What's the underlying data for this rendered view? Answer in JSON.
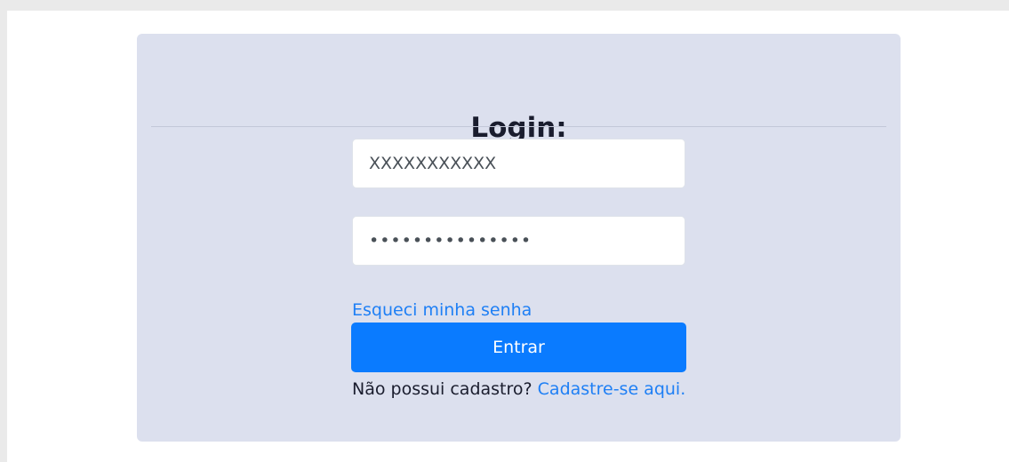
{
  "login": {
    "title": "Login:",
    "username_value": "XXXXXXXXXXX",
    "password_value": "PasswordExample",
    "forgot_label": "Esqueci minha senha",
    "submit_label": "Entrar",
    "signup_prompt": "Não possui cadastro?",
    "signup_link": "Cadastre-se aqui."
  },
  "colors": {
    "page_bg": "#eaeaea",
    "frame_bg": "#ffffff",
    "card_bg": "#dce0ee",
    "primary": "#0a7bff",
    "link": "#1e7ff5",
    "text": "#1a1d2e"
  }
}
